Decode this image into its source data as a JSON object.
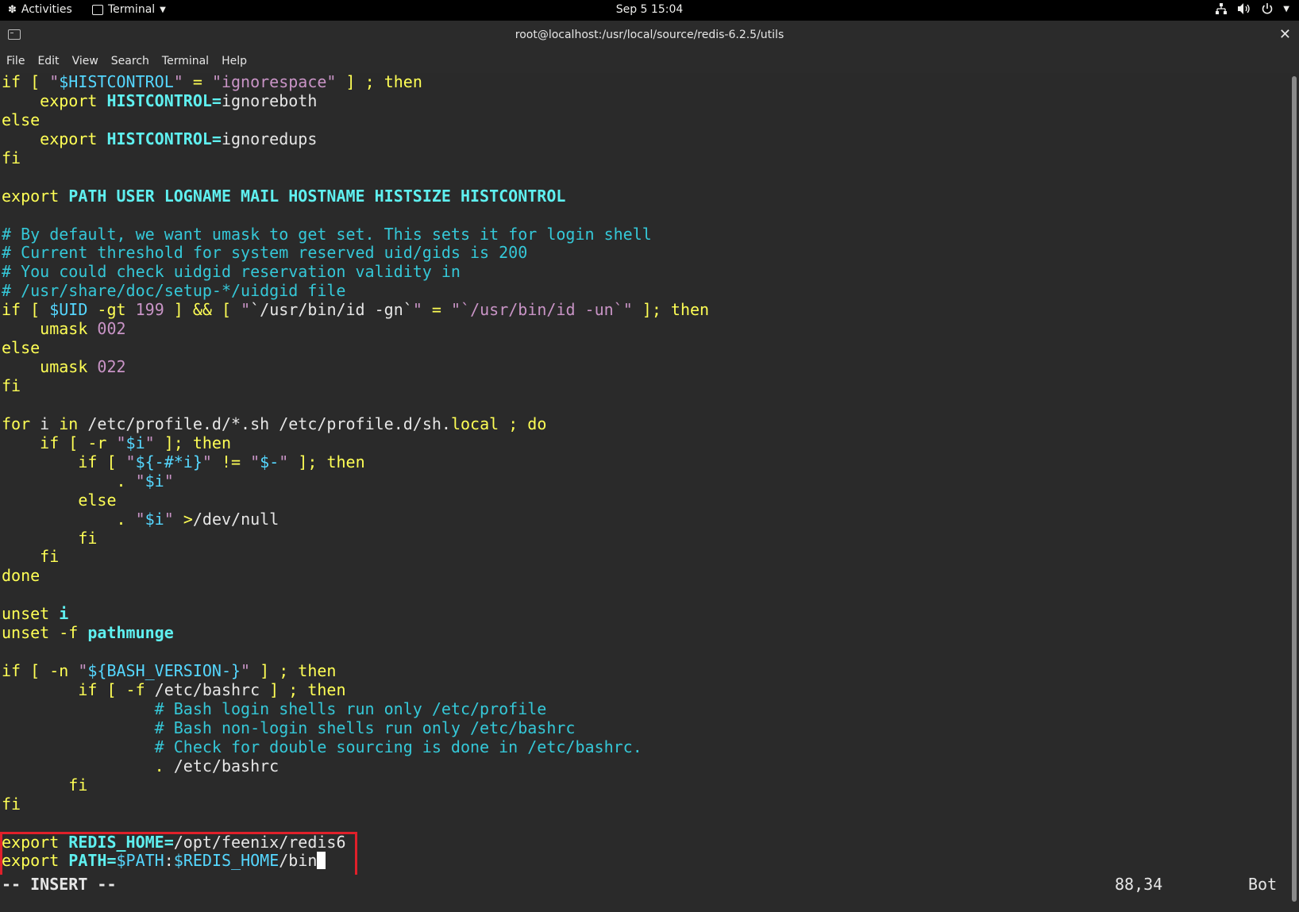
{
  "topbar": {
    "activities": "Activities",
    "app_menu": "Terminal",
    "clock": "Sep 5  15:04"
  },
  "window": {
    "title": "root@localhost:/usr/local/source/redis-6.2.5/utils",
    "close": "✕"
  },
  "menu": [
    "File",
    "Edit",
    "View",
    "Search",
    "Terminal",
    "Help"
  ],
  "editor": {
    "lines": [
      [
        [
          "kw",
          "if [ "
        ],
        [
          "str",
          "\""
        ],
        [
          "var",
          "$HISTCONTROL"
        ],
        [
          "str",
          "\""
        ],
        [
          "",
          ""
        ],
        [
          "kw",
          " = "
        ],
        [
          "str",
          "\"ignorespace\""
        ],
        [
          "kw",
          " ] ; then"
        ]
      ],
      [
        [
          "",
          "    "
        ],
        [
          "kw",
          "export "
        ],
        [
          "id",
          "HISTCONTROL="
        ],
        [
          "",
          "ignoreboth"
        ]
      ],
      [
        [
          "kw",
          "else"
        ]
      ],
      [
        [
          "",
          "    "
        ],
        [
          "kw",
          "export "
        ],
        [
          "id",
          "HISTCONTROL="
        ],
        [
          "",
          "ignoredups"
        ]
      ],
      [
        [
          "kw",
          "fi"
        ]
      ],
      [
        [
          "",
          ""
        ]
      ],
      [
        [
          "kw",
          "export "
        ],
        [
          "id",
          "PATH USER LOGNAME MAIL HOSTNAME HISTSIZE HISTCONTROL"
        ]
      ],
      [
        [
          "",
          ""
        ]
      ],
      [
        [
          "cm",
          "# By default, we want umask to get set. This sets it for login shell"
        ]
      ],
      [
        [
          "cm",
          "# Current threshold for system reserved uid/gids is 200"
        ]
      ],
      [
        [
          "cm",
          "# You could check uidgid reservation validity in"
        ]
      ],
      [
        [
          "cm",
          "# /usr/share/doc/setup-*/uidgid file"
        ]
      ],
      [
        [
          "kw",
          "if [ "
        ],
        [
          "var",
          "$UID"
        ],
        [
          "kw",
          " -gt "
        ],
        [
          "num",
          "199"
        ],
        [
          "kw",
          " ] && [ "
        ],
        [
          "str",
          "\""
        ],
        [
          "",
          "`/usr/bin/id -gn`"
        ],
        [
          "str",
          "\""
        ],
        [
          "kw",
          " = "
        ],
        [
          "str",
          "\"`/usr/bin/id -un`\""
        ],
        [
          "kw",
          " ]; then"
        ]
      ],
      [
        [
          "",
          "    "
        ],
        [
          "kw",
          "umask "
        ],
        [
          "num",
          "002"
        ]
      ],
      [
        [
          "kw",
          "else"
        ]
      ],
      [
        [
          "",
          "    "
        ],
        [
          "kw",
          "umask "
        ],
        [
          "num",
          "022"
        ]
      ],
      [
        [
          "kw",
          "fi"
        ]
      ],
      [
        [
          "",
          ""
        ]
      ],
      [
        [
          "kw",
          "for "
        ],
        [
          "",
          "i "
        ],
        [
          "kw",
          "in "
        ],
        [
          "",
          "/etc/profile.d/*.sh /etc/profile.d/sh."
        ],
        [
          "kw",
          "local"
        ],
        [
          "kw",
          " ; do"
        ]
      ],
      [
        [
          "",
          "    "
        ],
        [
          "kw",
          "if [ -r "
        ],
        [
          "str",
          "\""
        ],
        [
          "var",
          "$i"
        ],
        [
          "str",
          "\""
        ],
        [
          "kw",
          " ]; then"
        ]
      ],
      [
        [
          "",
          "        "
        ],
        [
          "kw",
          "if [ "
        ],
        [
          "str",
          "\""
        ],
        [
          "var",
          "${-#*i}"
        ],
        [
          "str",
          "\""
        ],
        [
          "kw",
          " != "
        ],
        [
          "str",
          "\""
        ],
        [
          "var",
          "$-"
        ],
        [
          "str",
          "\""
        ],
        [
          "kw",
          " ]; then"
        ]
      ],
      [
        [
          "",
          "            "
        ],
        [
          "kw",
          ". "
        ],
        [
          "str",
          "\""
        ],
        [
          "var",
          "$i"
        ],
        [
          "str",
          "\""
        ]
      ],
      [
        [
          "",
          "        "
        ],
        [
          "kw",
          "else"
        ]
      ],
      [
        [
          "",
          "            "
        ],
        [
          "kw",
          ". "
        ],
        [
          "str",
          "\""
        ],
        [
          "var",
          "$i"
        ],
        [
          "str",
          "\""
        ],
        [
          "kw",
          " >"
        ],
        [
          "",
          "/dev/null"
        ]
      ],
      [
        [
          "",
          "        "
        ],
        [
          "kw",
          "fi"
        ]
      ],
      [
        [
          "",
          "    "
        ],
        [
          "kw",
          "fi"
        ]
      ],
      [
        [
          "kw",
          "done"
        ]
      ],
      [
        [
          "",
          ""
        ]
      ],
      [
        [
          "kw",
          "unset "
        ],
        [
          "id",
          "i"
        ]
      ],
      [
        [
          "kw",
          "unset -f "
        ],
        [
          "id",
          "pathmunge"
        ]
      ],
      [
        [
          "",
          ""
        ]
      ],
      [
        [
          "kw",
          "if [ -n "
        ],
        [
          "str",
          "\""
        ],
        [
          "var",
          "${BASH_VERSION-}"
        ],
        [
          "str",
          "\""
        ],
        [
          "kw",
          " ] ; then"
        ]
      ],
      [
        [
          "",
          "        "
        ],
        [
          "kw",
          "if [ -f "
        ],
        [
          "",
          "/etc/bashrc "
        ],
        [
          "kw",
          "] ; then"
        ]
      ],
      [
        [
          "",
          "                "
        ],
        [
          "cm",
          "# Bash login shells run only /etc/profile"
        ]
      ],
      [
        [
          "",
          "                "
        ],
        [
          "cm",
          "# Bash non-login shells run only /etc/bashrc"
        ]
      ],
      [
        [
          "",
          "                "
        ],
        [
          "cm",
          "# Check for double sourcing is done in /etc/bashrc."
        ]
      ],
      [
        [
          "",
          "                "
        ],
        [
          "kw",
          ". "
        ],
        [
          "",
          "/etc/bashrc"
        ]
      ],
      [
        [
          "",
          "       "
        ],
        [
          "kw",
          "fi"
        ]
      ],
      [
        [
          "kw",
          "fi"
        ]
      ],
      [
        [
          "",
          ""
        ]
      ],
      [
        [
          "kw",
          "export "
        ],
        [
          "id",
          "REDIS_HOME="
        ],
        [
          "",
          "/opt/feenix/redis6"
        ]
      ],
      [
        [
          "kw",
          "export "
        ],
        [
          "id",
          "PATH="
        ],
        [
          "var",
          "$PATH"
        ],
        [
          "",
          ":"
        ],
        [
          "var",
          "$REDIS_HOME"
        ],
        [
          "",
          "/bin"
        ]
      ]
    ],
    "status_mode": "-- INSERT --",
    "status_position": "88,34",
    "status_where": "Bot"
  },
  "colors": {
    "keyword": "#ffff55",
    "string": "#c994c6",
    "variable": "#55d7ff",
    "identifier": "#5ff0f0",
    "comment": "#35c8d8",
    "highlight_box": "#e0202a"
  }
}
